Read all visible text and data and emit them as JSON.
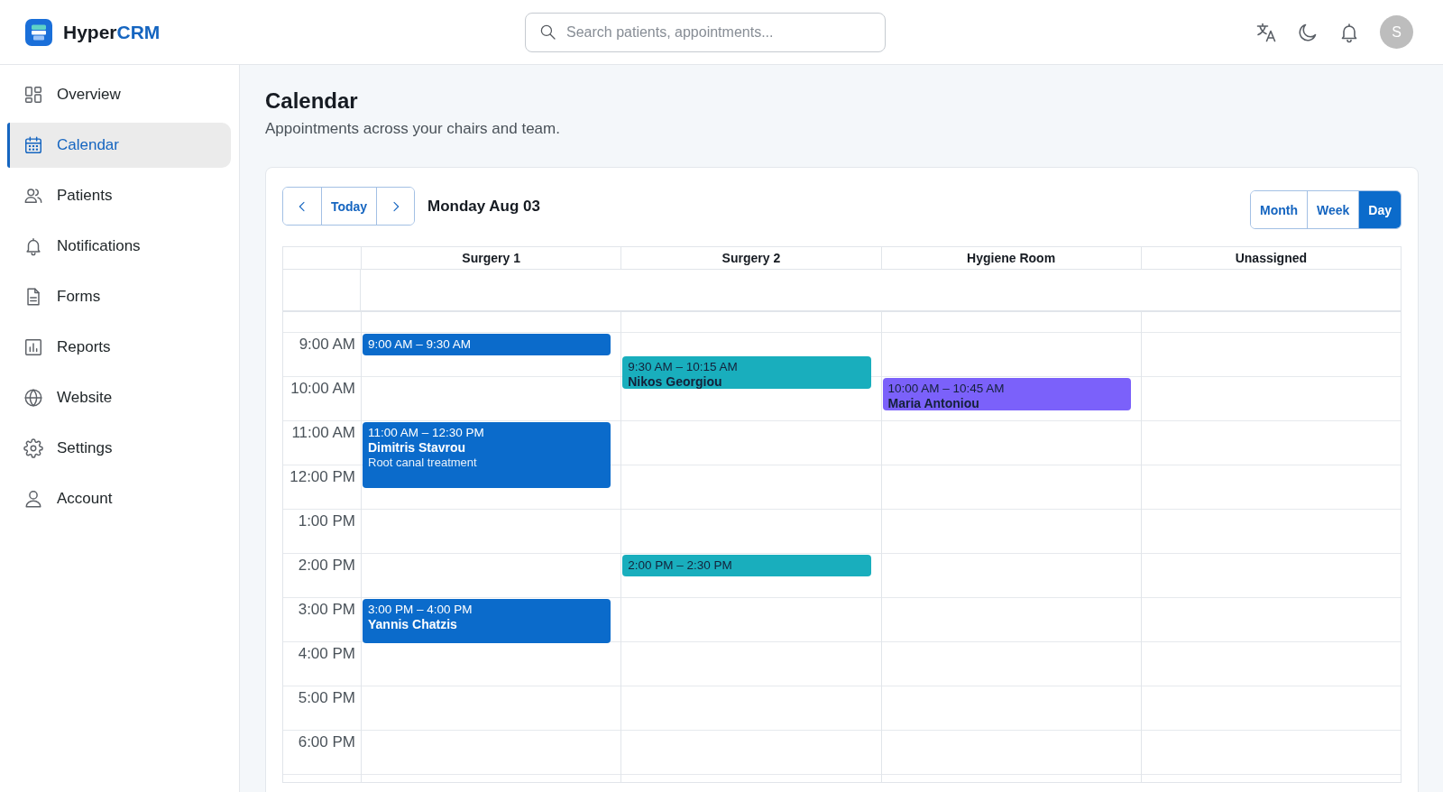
{
  "header": {
    "brand": {
      "name": "Hyper",
      "accent": "CRM"
    },
    "search": {
      "placeholder": "Search patients, appointments..."
    },
    "avatar": {
      "initial": "S"
    }
  },
  "sidebar": {
    "items": [
      {
        "label": "Overview",
        "kind": "dashboard",
        "selected": false
      },
      {
        "label": "Calendar",
        "kind": "calendar",
        "selected": true
      },
      {
        "label": "Patients",
        "kind": "people",
        "selected": false
      },
      {
        "label": "Notifications",
        "kind": "bell",
        "selected": false
      },
      {
        "label": "Forms",
        "kind": "document",
        "selected": false
      },
      {
        "label": "Reports",
        "kind": "chart",
        "selected": false
      },
      {
        "label": "Website",
        "kind": "globe",
        "selected": false
      },
      {
        "label": "Settings",
        "kind": "gear",
        "selected": false
      },
      {
        "label": "Account",
        "kind": "person",
        "selected": false
      }
    ]
  },
  "page": {
    "title": "Calendar",
    "subtitle": "Appointments across your chairs and team."
  },
  "calendar": {
    "today_label": "Today",
    "date": "Monday Aug 03",
    "views": [
      {
        "label": "Month",
        "selected": false
      },
      {
        "label": "Week",
        "selected": false
      },
      {
        "label": "Day",
        "selected": true
      }
    ],
    "hours": [
      "9:00 AM",
      "10:00 AM",
      "11:00 AM",
      "12:00 PM",
      "1:00 PM",
      "2:00 PM",
      "3:00 PM",
      "4:00 PM",
      "5:00 PM",
      "6:00 PM"
    ],
    "columns": [
      {
        "name": "Surgery 1",
        "events": [
          {
            "time": "9:00 AM – 9:30 AM",
            "color": "#0b6bcb"
          },
          {
            "time": "11:00 AM – 12:30 PM",
            "patient": "Dimitris Stavrou",
            "treatment": "Root canal treatment",
            "color": "#0b6bcb"
          },
          {
            "time": "3:00 PM – 4:00 PM",
            "patient": "Yannis Chatzis",
            "color": "#0b6bcb"
          }
        ]
      },
      {
        "name": "Surgery 2",
        "events": [
          {
            "time": "9:30 AM – 10:15 AM",
            "patient": "Nikos Georgiou",
            "color": "#19aebd"
          },
          {
            "time": "2:00 PM – 2:30 PM",
            "color": "#19aebd"
          }
        ]
      },
      {
        "name": "Hygiene Room",
        "events": [
          {
            "time": "10:00 AM – 10:45 AM",
            "patient": "Maria Antoniou",
            "color": "#7b61fa"
          }
        ]
      },
      {
        "name": "Unassigned"
      }
    ]
  }
}
